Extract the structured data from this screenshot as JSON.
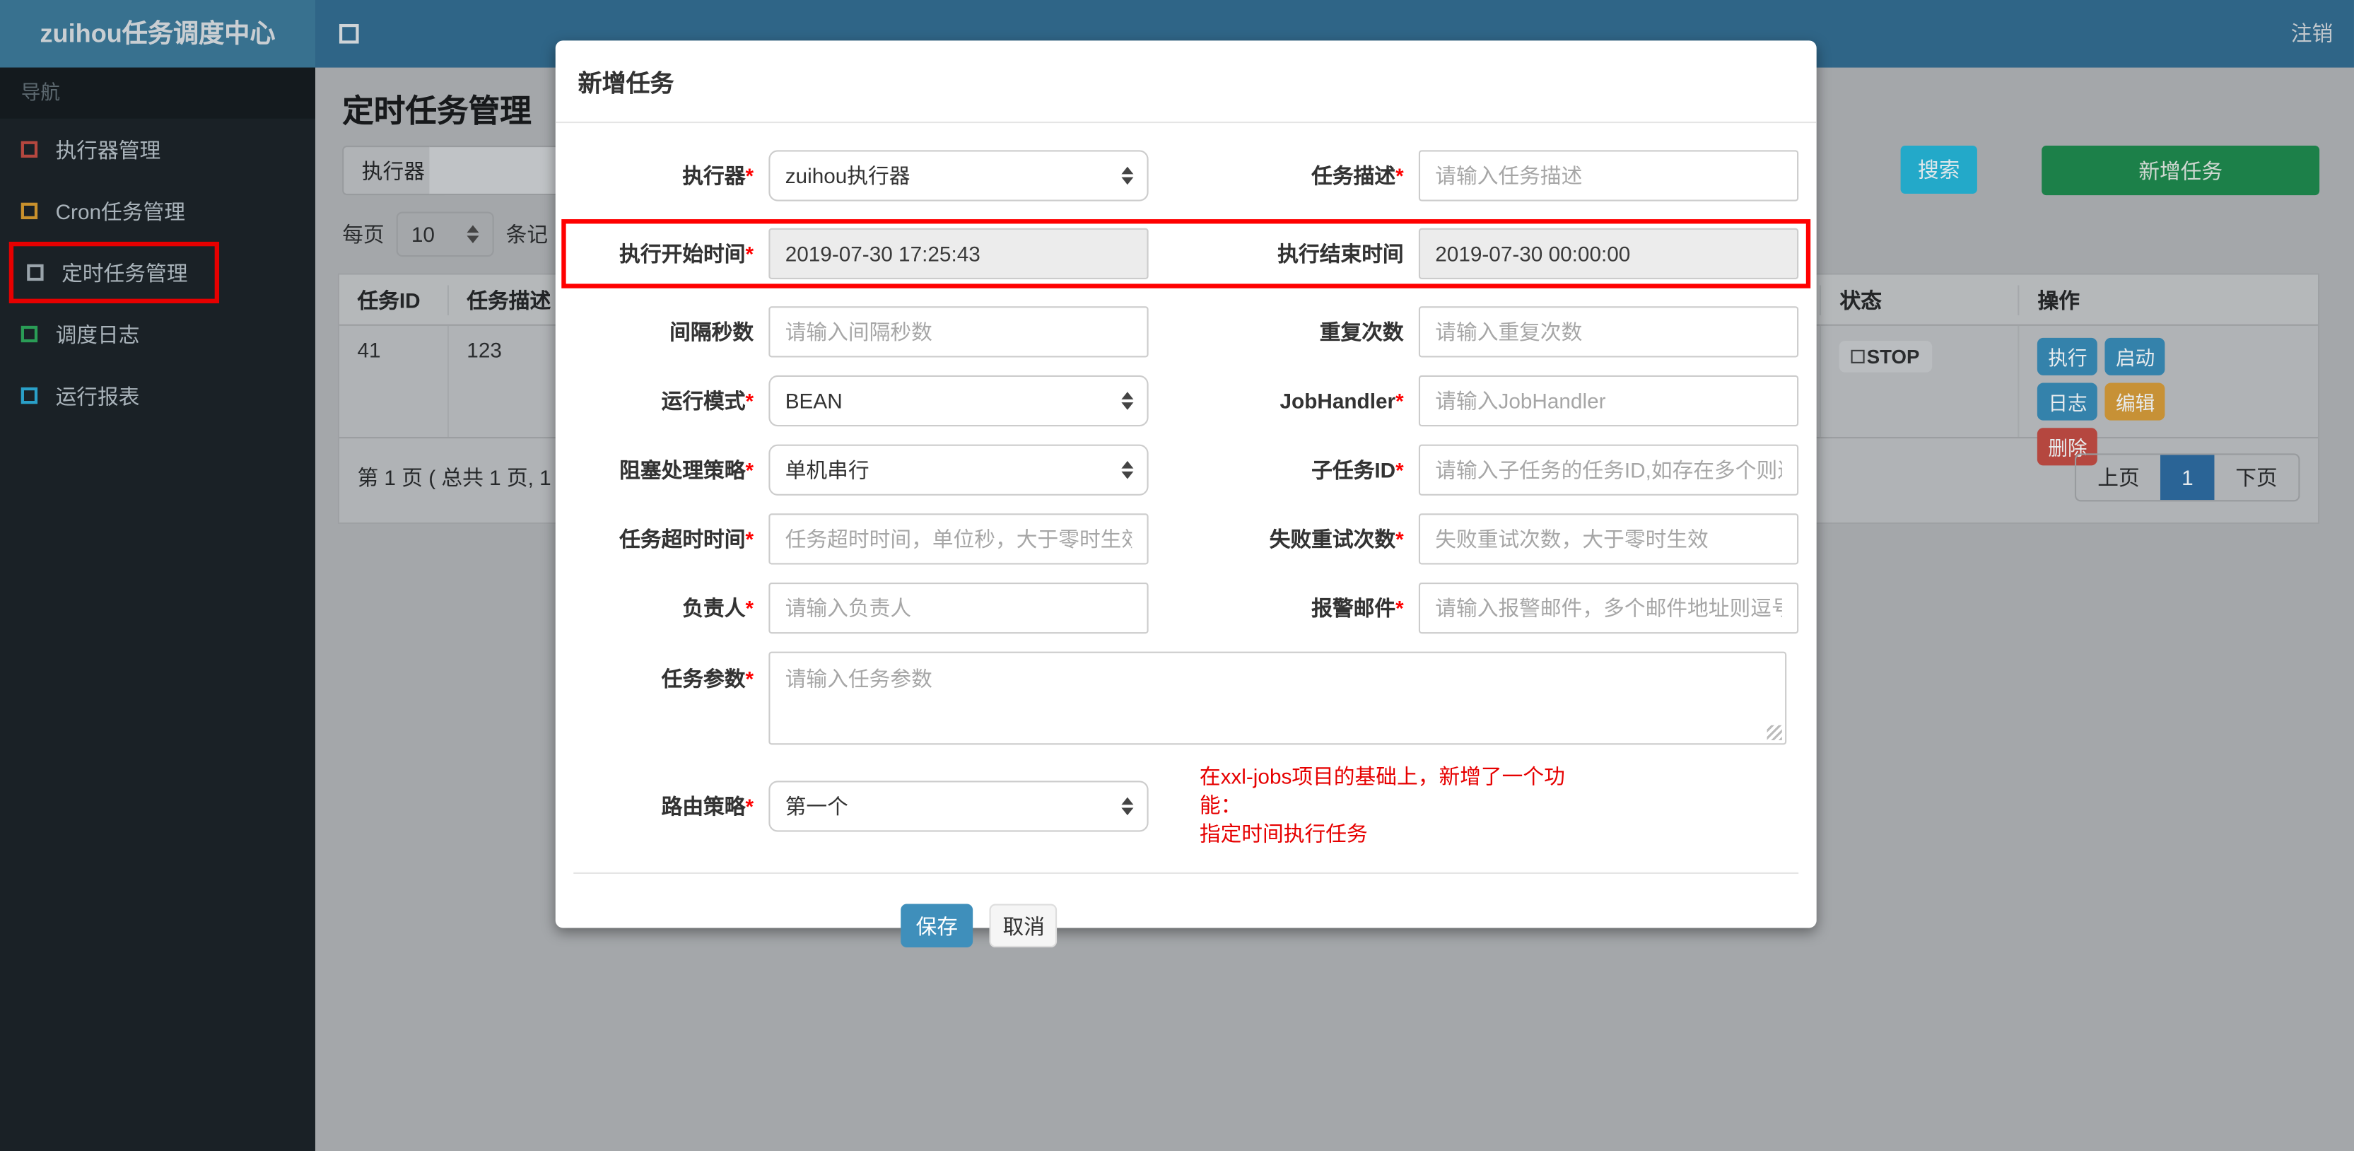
{
  "colors": {
    "topbar": "#2f6587",
    "brand_bg": "#38718f",
    "sidebar_bg": "#1a2126",
    "content_bg": "#a4a7aa",
    "accent_red": "#e60000",
    "required_mark": "#ff0000",
    "note_red": "#e60000",
    "search_button": "#23a9c9",
    "add_button": "#1c8049",
    "save_button": "#3f8fbb",
    "action_blue": "#3482ab",
    "action_orange": "#c79136",
    "action_red": "#b5473f",
    "pagination_active": "#2a6496",
    "menu_icon_red": "#b5473f",
    "menu_icon_orange": "#c9912c",
    "menu_icon_gray": "#9aa4ab",
    "menu_icon_green": "#2a9d56",
    "menu_icon_teal": "#2aa0c8"
  },
  "topbar": {
    "brand": "zuihou任务调度中心",
    "logout": "注销"
  },
  "sidebar": {
    "nav_label": "导航",
    "items": [
      {
        "label": "执行器管理"
      },
      {
        "label": "Cron任务管理"
      },
      {
        "label": "定时任务管理"
      },
      {
        "label": "调度日志"
      },
      {
        "label": "运行报表"
      }
    ]
  },
  "page": {
    "title": "定时任务管理",
    "filter": {
      "executor_label": "执行器",
      "search_button": "搜索",
      "add_button": "新增任务"
    },
    "per_page": {
      "prefix": "每页",
      "value": "10",
      "suffix": "条记"
    },
    "table": {
      "headers": {
        "id": "任务ID",
        "desc": "任务描述",
        "status": "状态",
        "actions": "操作"
      },
      "row": {
        "id": "41",
        "desc": "123",
        "status": "STOP"
      },
      "action_buttons": {
        "run": "执行",
        "start": "启动",
        "log": "日志",
        "edit": "编辑",
        "del": "删除"
      }
    },
    "pagination": {
      "summary": "第 1 页 ( 总共 1 页, 1",
      "prev": "上页",
      "current": "1",
      "next": "下页"
    }
  },
  "modal": {
    "title": "新增任务",
    "required_mark": "*",
    "fields": {
      "executor": {
        "label": "执行器",
        "value": "zuihou执行器"
      },
      "job_desc": {
        "label": "任务描述",
        "placeholder": "请输入任务描述"
      },
      "start_time": {
        "label": "执行开始时间",
        "value": "2019-07-30 17:25:43"
      },
      "end_time": {
        "label": "执行结束时间",
        "value": "2019-07-30 00:00:00"
      },
      "interval": {
        "label": "间隔秒数",
        "placeholder": "请输入间隔秒数"
      },
      "repeat": {
        "label": "重复次数",
        "placeholder": "请输入重复次数"
      },
      "run_mode": {
        "label": "运行模式",
        "value": "BEAN"
      },
      "job_handler": {
        "label": "JobHandler",
        "placeholder": "请输入JobHandler"
      },
      "block_strategy": {
        "label": "阻塞处理策略",
        "value": "单机串行"
      },
      "child_job": {
        "label": "子任务ID",
        "placeholder": "请输入子任务的任务ID,如存在多个则逗号分隔"
      },
      "timeout": {
        "label": "任务超时时间",
        "placeholder": "任务超时时间，单位秒，大于零时生效"
      },
      "fail_retry": {
        "label": "失败重试次数",
        "placeholder": "失败重试次数，大于零时生效"
      },
      "owner": {
        "label": "负责人",
        "placeholder": "请输入负责人"
      },
      "alarm_email": {
        "label": "报警邮件",
        "placeholder": "请输入报警邮件，多个邮件地址则逗号分隔"
      },
      "job_param": {
        "label": "任务参数",
        "placeholder": "请输入任务参数"
      },
      "route_strategy": {
        "label": "路由策略",
        "value": "第一个"
      }
    },
    "note": {
      "line1": "在xxl-jobs项目的基础上，新增了一个功能：",
      "line2": "指定时间执行任务"
    },
    "save_button": "保存",
    "cancel_button": "取消"
  }
}
